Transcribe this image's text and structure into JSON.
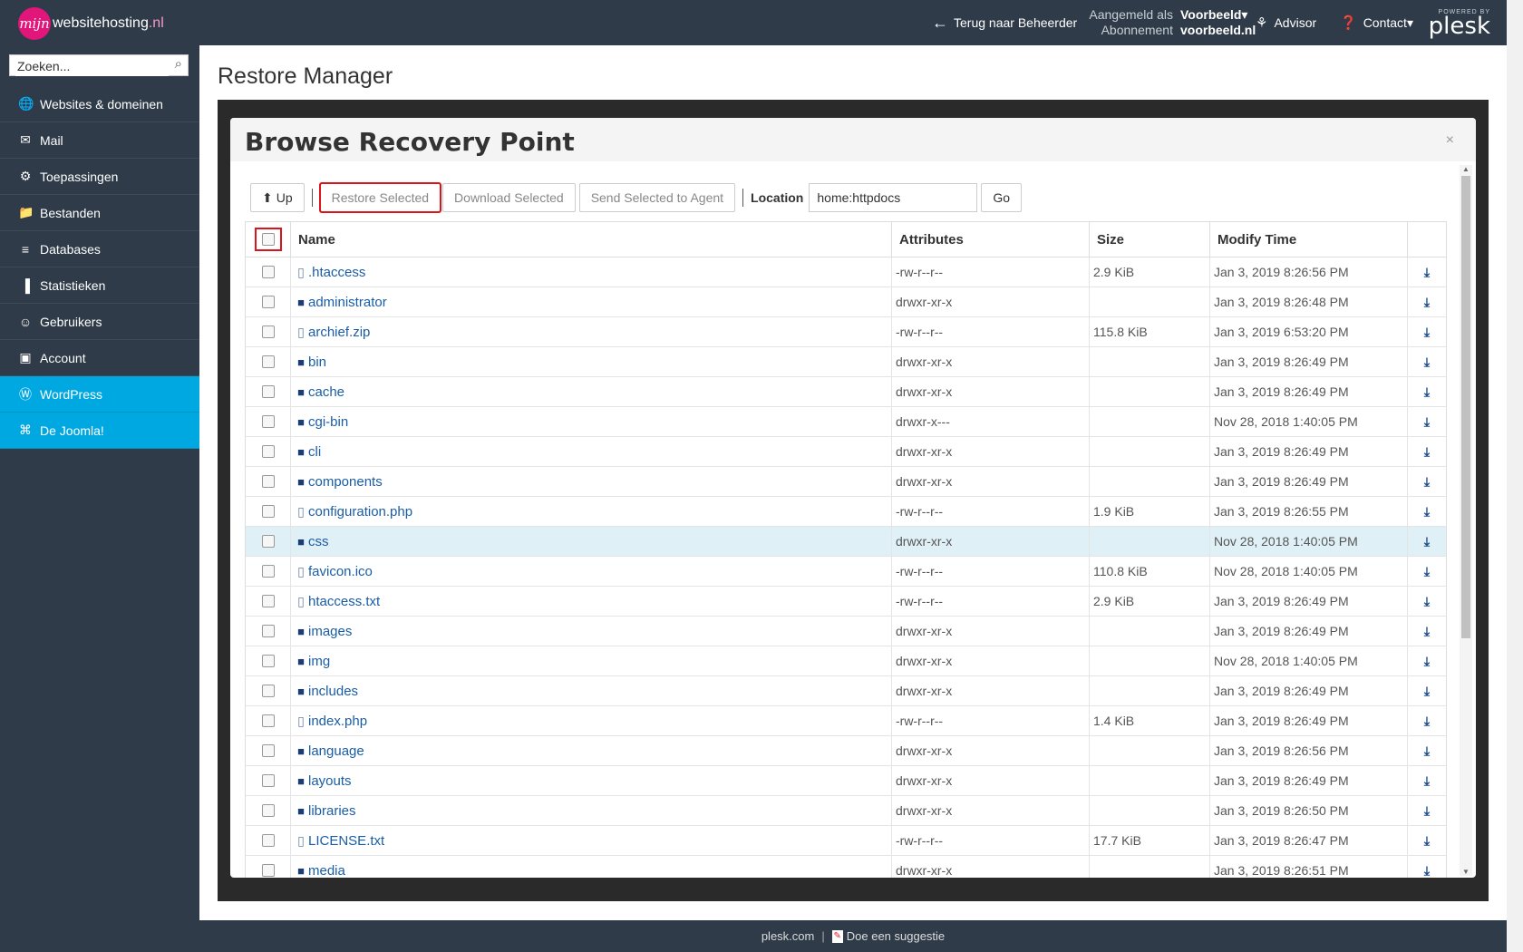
{
  "brand": {
    "logo_mark": "mijn",
    "name": "websitehosting",
    "tld": ".nl"
  },
  "topbar": {
    "back_label": "Terug naar Beheerder",
    "logged_in_label": "Aangemeld als",
    "logged_in_value": "Voorbeeld",
    "subscription_label": "Abonnement",
    "subscription_value": "voorbeeld.nl",
    "advisor_label": "Advisor",
    "contact_label": "Contact",
    "powered_by": "POWERED BY",
    "plesk": "plesk"
  },
  "sidebar": {
    "search_placeholder": "Zoeken...",
    "items": [
      {
        "label": "Websites & domeinen",
        "icon": "globe-icon"
      },
      {
        "label": "Mail",
        "icon": "envelope-icon"
      },
      {
        "label": "Toepassingen",
        "icon": "gear-icon"
      },
      {
        "label": "Bestanden",
        "icon": "folder-icon"
      },
      {
        "label": "Databases",
        "icon": "database-icon"
      },
      {
        "label": "Statistieken",
        "icon": "bar-chart-icon"
      },
      {
        "label": "Gebruikers",
        "icon": "user-icon"
      },
      {
        "label": "Account",
        "icon": "account-icon"
      },
      {
        "label": "WordPress",
        "icon": "wordpress-icon",
        "active": true
      },
      {
        "label": "De Joomla!",
        "icon": "joomla-icon",
        "active": true
      }
    ]
  },
  "page": {
    "title": "Restore Manager"
  },
  "modal": {
    "title": "Browse Recovery Point",
    "close": "×",
    "toolbar": {
      "up_label": "Up",
      "restore_label": "Restore Selected",
      "download_label": "Download Selected",
      "send_label": "Send Selected to Agent",
      "location_label": "Location",
      "location_value": "home:httpdocs",
      "go_label": "Go"
    },
    "columns": {
      "name": "Name",
      "attributes": "Attributes",
      "size": "Size",
      "modified": "Modify Time"
    },
    "rows": [
      {
        "name": ".htaccess",
        "type": "file",
        "attr": "-rw-r--r--",
        "size": "2.9 KiB",
        "modified": "Jan 3, 2019 8:26:56 PM"
      },
      {
        "name": "administrator",
        "type": "folder",
        "attr": "drwxr-xr-x",
        "size": "",
        "modified": "Jan 3, 2019 8:26:48 PM"
      },
      {
        "name": "archief.zip",
        "type": "file",
        "attr": "-rw-r--r--",
        "size": "115.8 KiB",
        "modified": "Jan 3, 2019 6:53:20 PM"
      },
      {
        "name": "bin",
        "type": "folder",
        "attr": "drwxr-xr-x",
        "size": "",
        "modified": "Jan 3, 2019 8:26:49 PM"
      },
      {
        "name": "cache",
        "type": "folder",
        "attr": "drwxr-xr-x",
        "size": "",
        "modified": "Jan 3, 2019 8:26:49 PM"
      },
      {
        "name": "cgi-bin",
        "type": "folder",
        "attr": "drwxr-x---",
        "size": "",
        "modified": "Nov 28, 2018 1:40:05 PM"
      },
      {
        "name": "cli",
        "type": "folder",
        "attr": "drwxr-xr-x",
        "size": "",
        "modified": "Jan 3, 2019 8:26:49 PM"
      },
      {
        "name": "components",
        "type": "folder",
        "attr": "drwxr-xr-x",
        "size": "",
        "modified": "Jan 3, 2019 8:26:49 PM"
      },
      {
        "name": "configuration.php",
        "type": "file",
        "attr": "-rw-r--r--",
        "size": "1.9 KiB",
        "modified": "Jan 3, 2019 8:26:55 PM"
      },
      {
        "name": "css",
        "type": "folder",
        "attr": "drwxr-xr-x",
        "size": "",
        "modified": "Nov 28, 2018 1:40:05 PM",
        "selected": true
      },
      {
        "name": "favicon.ico",
        "type": "file",
        "attr": "-rw-r--r--",
        "size": "110.8 KiB",
        "modified": "Nov 28, 2018 1:40:05 PM"
      },
      {
        "name": "htaccess.txt",
        "type": "file",
        "attr": "-rw-r--r--",
        "size": "2.9 KiB",
        "modified": "Jan 3, 2019 8:26:49 PM"
      },
      {
        "name": "images",
        "type": "folder",
        "attr": "drwxr-xr-x",
        "size": "",
        "modified": "Jan 3, 2019 8:26:49 PM"
      },
      {
        "name": "img",
        "type": "folder",
        "attr": "drwxr-xr-x",
        "size": "",
        "modified": "Nov 28, 2018 1:40:05 PM"
      },
      {
        "name": "includes",
        "type": "folder",
        "attr": "drwxr-xr-x",
        "size": "",
        "modified": "Jan 3, 2019 8:26:49 PM"
      },
      {
        "name": "index.php",
        "type": "file",
        "attr": "-rw-r--r--",
        "size": "1.4 KiB",
        "modified": "Jan 3, 2019 8:26:49 PM"
      },
      {
        "name": "language",
        "type": "folder",
        "attr": "drwxr-xr-x",
        "size": "",
        "modified": "Jan 3, 2019 8:26:56 PM"
      },
      {
        "name": "layouts",
        "type": "folder",
        "attr": "drwxr-xr-x",
        "size": "",
        "modified": "Jan 3, 2019 8:26:49 PM"
      },
      {
        "name": "libraries",
        "type": "folder",
        "attr": "drwxr-xr-x",
        "size": "",
        "modified": "Jan 3, 2019 8:26:50 PM"
      },
      {
        "name": "LICENSE.txt",
        "type": "file",
        "attr": "-rw-r--r--",
        "size": "17.7 KiB",
        "modified": "Jan 3, 2019 8:26:47 PM"
      },
      {
        "name": "media",
        "type": "folder",
        "attr": "drwxr-xr-x",
        "size": "",
        "modified": "Jan 3, 2019 8:26:51 PM"
      }
    ]
  },
  "footer": {
    "link1": "plesk.com",
    "separator": "|",
    "link2": "Doe een suggestie"
  },
  "colors": {
    "topbar": "#2f3b48",
    "accent": "#00a8e1",
    "brand": "#e2157a",
    "highlight": "#d9141b"
  }
}
